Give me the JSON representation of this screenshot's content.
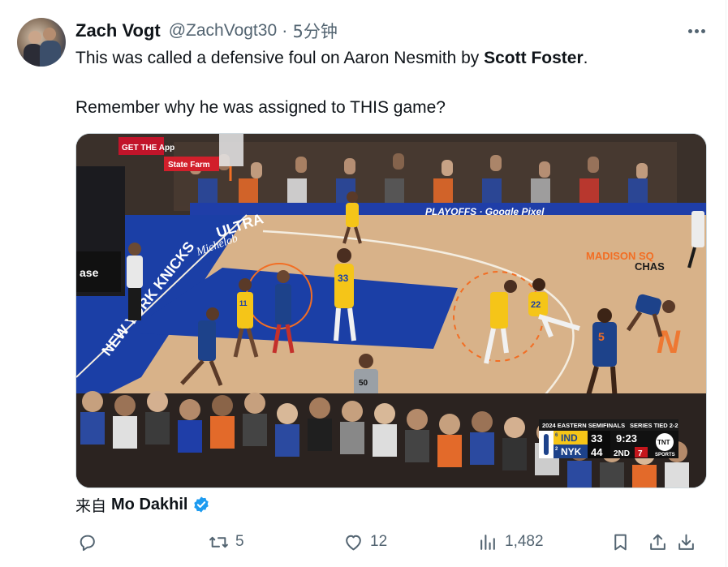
{
  "tweet": {
    "author_name": "Zach Vogt",
    "author_handle": "@ZachVogt30",
    "separator": "·",
    "time": "5分钟",
    "text_line1_before": "This was called a defensive foul on Aaron Nesmith by ",
    "text_line1_bold": "Scott Foster",
    "text_line1_after": ".",
    "text_line2": "Remember why he was assigned to THIS game?"
  },
  "media": {
    "scorebug": {
      "series_title": "2024 EASTERN SEMIFINALS",
      "series_status": "SERIES TIED 2-2",
      "team1": "IND",
      "team1_seed": "6",
      "team1_score": "33",
      "team2": "NYK",
      "team2_seed": "2",
      "team2_score": "44",
      "clock": "9:23",
      "period": "2ND",
      "shot_clock": "7",
      "network": "TNT",
      "network_sub": "SPORTS"
    },
    "arena_texts": {
      "app_sign": "GET THE App",
      "statefarm": "State Farm",
      "madison": "MADISON SQ",
      "chase": "CHAS",
      "playoffs": "PLAYOFFS · Google Pixel",
      "knicks_floor": "NEW YORK KNICKS",
      "ultra": "ULTRA",
      "michelob": "Michelob",
      "ase": "ase",
      "ref_number": "50",
      "jersey_33": "33",
      "jersey_22": "22",
      "jersey_5": "5",
      "jersey_11": "11"
    }
  },
  "source": {
    "prefix": "来自",
    "name": "Mo Dakhil"
  },
  "actions": {
    "reply_count": "",
    "retweet_count": "5",
    "like_count": "12",
    "views_count": "1,482"
  },
  "colors": {
    "text": "#0f1419",
    "secondary": "#536471",
    "verified": "#1d9bf0",
    "court_blue": "#1b3fa6",
    "court_wood": "#d9b48a",
    "pacers_gold": "#f5c518",
    "knicks_orange": "#f26e24"
  },
  "icons": [
    "reply-icon",
    "retweet-icon",
    "like-icon",
    "views-icon",
    "bookmark-icon",
    "share-icon",
    "download-icon",
    "more-icon",
    "verified-icon"
  ]
}
